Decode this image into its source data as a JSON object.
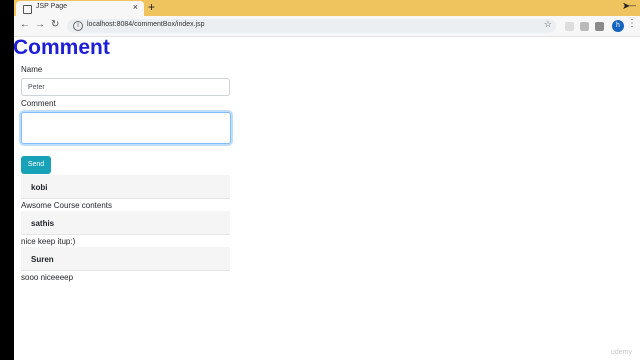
{
  "browser": {
    "tab_title": "JSP Page",
    "tab_close": "×",
    "new_tab": "+",
    "url": "localhost:8084/commentBox/index.jsp",
    "back": "←",
    "forward": "→",
    "reload": "↻",
    "star": "☆",
    "profile_initial": "h",
    "menu": "⋮",
    "window_control": "—"
  },
  "page": {
    "heading": "Comment",
    "name_label": "Name",
    "name_value": "Peter",
    "comment_label": "Comment",
    "comment_value": "",
    "send_label": "Send"
  },
  "comments": [
    {
      "author": "kobi",
      "text": "Awsome Course contents"
    },
    {
      "author": "sathis",
      "text": "nice keep itup:)"
    },
    {
      "author": "Suren",
      "text": "sooo niceeeep"
    }
  ],
  "watermark": "udemy",
  "colors": {
    "heading": "#1d1fd7",
    "send_button": "#17a2b8",
    "titlebar": "#efc35e"
  }
}
